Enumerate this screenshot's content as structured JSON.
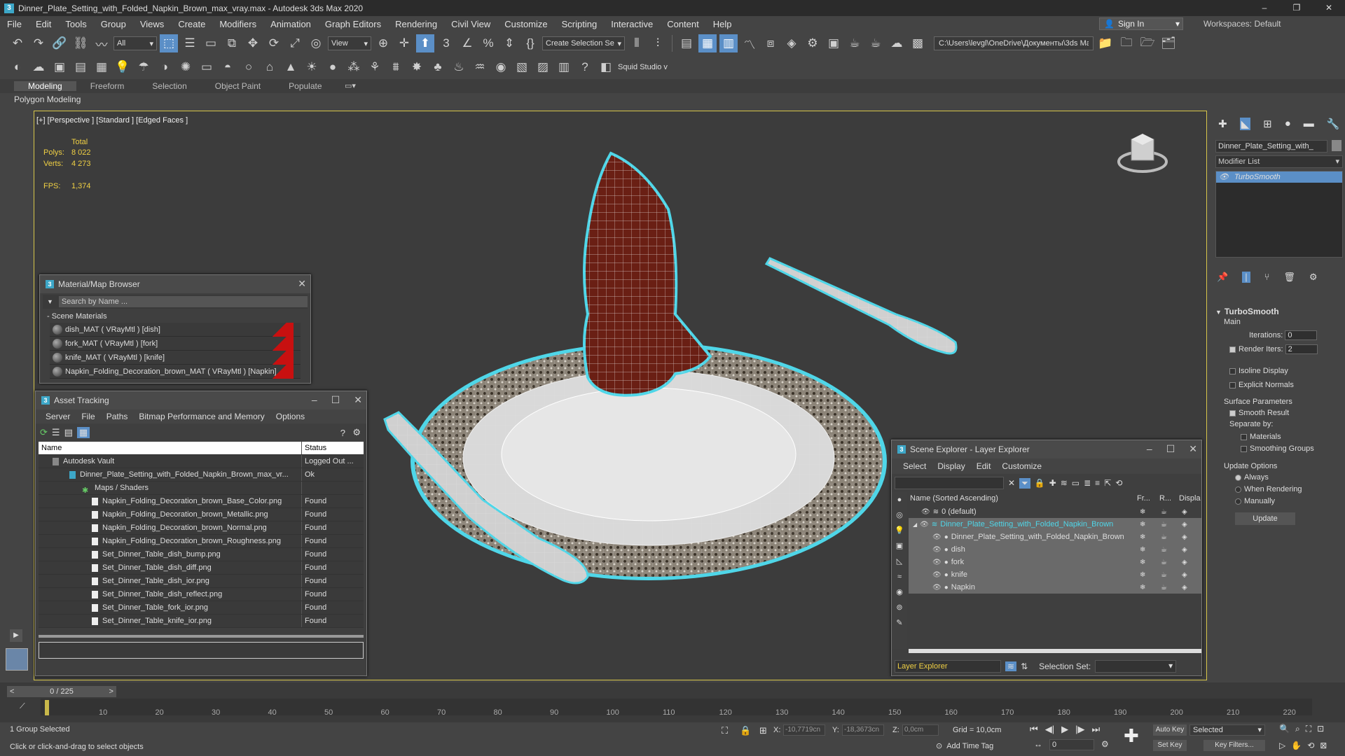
{
  "app": {
    "title": "Dinner_Plate_Setting_with_Folded_Napkin_Brown_max_vray.max - Autodesk 3ds Max 2020",
    "signin": "Sign In",
    "workspaces_label": "Workspaces:",
    "workspace": "Default"
  },
  "menu": [
    "File",
    "Edit",
    "Tools",
    "Group",
    "Views",
    "Create",
    "Modifiers",
    "Animation",
    "Graph Editors",
    "Rendering",
    "Civil View",
    "Customize",
    "Scripting",
    "Interactive",
    "Content",
    "Help"
  ],
  "toolbar": {
    "filter": "All",
    "view": "View",
    "create_selection": "Create Selection Se",
    "path": "C:\\Users\\levgl\\OneDrive\\Документы\\3ds Max 2020",
    "squid": "Squid Studio v"
  },
  "ribbon": {
    "tabs": [
      "Modeling",
      "Freeform",
      "Selection",
      "Object Paint",
      "Populate"
    ],
    "sub": "Polygon Modeling"
  },
  "viewport": {
    "label": "[+] [Perspective ] [Standard ] [Edged Faces ]",
    "total": "Total",
    "polys_label": "Polys:",
    "polys": "8 022",
    "verts_label": "Verts:",
    "verts": "4 273",
    "fps_label": "FPS:",
    "fps": "1,374"
  },
  "material_browser": {
    "title": "Material/Map Browser",
    "search": "Search by Name ...",
    "section": "- Scene Materials",
    "items": [
      "dish_MAT ( VRayMtl ) [dish]",
      "fork_MAT ( VRayMtl ) [fork]",
      "knife_MAT ( VRayMtl ) [knife]",
      "Napkin_Folding_Decoration_brown_MAT ( VRayMtl ) [Napkin]"
    ]
  },
  "asset_tracking": {
    "title": "Asset Tracking",
    "menu": [
      "Server",
      "File",
      "Paths",
      "Bitmap Performance and Memory",
      "Options"
    ],
    "col_name": "Name",
    "col_status": "Status",
    "rows": [
      {
        "name": "Autodesk Vault",
        "status": "Logged Out ..."
      },
      {
        "name": "Dinner_Plate_Setting_with_Folded_Napkin_Brown_max_vr...",
        "status": "Ok"
      },
      {
        "name": "Maps / Shaders",
        "status": ""
      },
      {
        "name": "Napkin_Folding_Decoration_brown_Base_Color.png",
        "status": "Found"
      },
      {
        "name": "Napkin_Folding_Decoration_brown_Metallic.png",
        "status": "Found"
      },
      {
        "name": "Napkin_Folding_Decoration_brown_Normal.png",
        "status": "Found"
      },
      {
        "name": "Napkin_Folding_Decoration_brown_Roughness.png",
        "status": "Found"
      },
      {
        "name": "Set_Dinner_Table_dish_bump.png",
        "status": "Found"
      },
      {
        "name": "Set_Dinner_Table_dish_diff.png",
        "status": "Found"
      },
      {
        "name": "Set_Dinner_Table_dish_ior.png",
        "status": "Found"
      },
      {
        "name": "Set_Dinner_Table_dish_reflect.png",
        "status": "Found"
      },
      {
        "name": "Set_Dinner_Table_fork_ior.png",
        "status": "Found"
      },
      {
        "name": "Set_Dinner_Table_knife_ior.png",
        "status": "Found"
      }
    ]
  },
  "scene_explorer": {
    "title": "Scene Explorer - Layer Explorer",
    "menu": [
      "Select",
      "Display",
      "Edit",
      "Customize"
    ],
    "col_name": "Name (Sorted Ascending)",
    "col_fr": "Fr...",
    "col_r": "R...",
    "col_disp": "Displa",
    "rows": [
      {
        "name": "0 (default)",
        "level": 1
      },
      {
        "name": "Dinner_Plate_Setting_with_Folded_Napkin_Brown",
        "level": 1
      },
      {
        "name": "Dinner_Plate_Setting_with_Folded_Napkin_Brown",
        "level": 2
      },
      {
        "name": "dish",
        "level": 2
      },
      {
        "name": "fork",
        "level": 2
      },
      {
        "name": "knife",
        "level": 2
      },
      {
        "name": "Napkin",
        "level": 2
      }
    ],
    "footer_explorer": "Layer Explorer",
    "footer_selset": "Selection Set:"
  },
  "command_panel": {
    "object_name": "Dinner_Plate_Setting_with_",
    "modifier_list": "Modifier List",
    "modifier": "TurboSmooth",
    "rollout": "TurboSmooth",
    "main": "Main",
    "iterations_label": "Iterations:",
    "iterations": "0",
    "render_iters_label": "Render Iters:",
    "render_iters": "2",
    "isoline": "Isoline Display",
    "explicit": "Explicit Normals",
    "surface_params": "Surface Parameters",
    "smooth_result": "Smooth Result",
    "separate_by": "Separate by:",
    "materials": "Materials",
    "smoothing_groups": "Smoothing Groups",
    "update_options": "Update Options",
    "always": "Always",
    "when_rendering": "When Rendering",
    "manually": "Manually",
    "update_btn": "Update"
  },
  "timeline": {
    "frame": "0 / 225",
    "ticks": [
      "10",
      "20",
      "30",
      "40",
      "50",
      "60",
      "70",
      "80",
      "90",
      "100",
      "110",
      "120",
      "130",
      "140",
      "150",
      "160",
      "170",
      "180",
      "190",
      "200",
      "210",
      "220"
    ]
  },
  "status": {
    "selected": "1 Group Selected",
    "hint": "Click or click-and-drag to select objects",
    "x_label": "X:",
    "x": "-10,7719cn",
    "y_label": "Y:",
    "y": "-18,3673cn",
    "z_label": "Z:",
    "z": "0,0cm",
    "grid": "Grid = 10,0cm",
    "add_time_tag": "Add Time Tag",
    "auto_key": "Auto Key",
    "set_key": "Set Key",
    "selected_dd": "Selected",
    "key_filters": "Key Filters...",
    "frame_spin": "0"
  },
  "colors": {
    "accent": "#5b8fc7",
    "selection": "#4fd6e8",
    "napkin": "#6a1f14",
    "viewport_border": "#d8c64a"
  }
}
